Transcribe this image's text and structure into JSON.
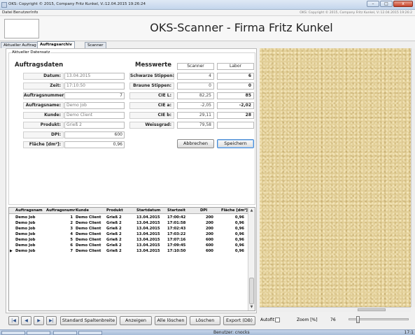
{
  "window": {
    "title": "OKS: Copyright © 2015, Company Fritz Kunkel, V.:12.04.2015 19:26:24",
    "min_label": "–",
    "max_label": "□",
    "close_label": "x"
  },
  "menu": {
    "items": [
      "Datei",
      "Benutzer",
      "Info"
    ],
    "right_text": "OKS: Copyright © 2015, Company Fritz Kunkel, V.:12.04.2015 19:26:2"
  },
  "header": {
    "title": "OKS-Scanner - Firma Fritz Kunkel"
  },
  "tabs": [
    "Aktueller Auftrag",
    "Auftragsarchiv",
    "Scanner"
  ],
  "group_label": "Aktueller Datensatz",
  "auftragsdaten": {
    "heading": "Auftragsdaten",
    "fields": [
      {
        "label": "Datum:",
        "value": "13.04.2015"
      },
      {
        "label": "Zeit:",
        "value": "17:10:50"
      },
      {
        "label": "Auftragsnummer:",
        "value": "7"
      },
      {
        "label": "Auftragsname:",
        "value": "Demo Job"
      },
      {
        "label": "Kunde:",
        "value": "Demo Client"
      },
      {
        "label": "Produkt:",
        "value": "Grieß 2"
      },
      {
        "label": "DPI:",
        "value": "600"
      },
      {
        "label": "Fläche [dm²]:",
        "value": "0,96"
      }
    ]
  },
  "messwerte": {
    "heading": "Messwerte",
    "col_scanner": "Scanner",
    "col_labor": "Labor",
    "rows": [
      {
        "label": "Schwarze Stippen:",
        "scanner": "4",
        "labor": "6"
      },
      {
        "label": "Braune Stippen:",
        "scanner": "0",
        "labor": "0"
      },
      {
        "label": "CIE L:",
        "scanner": "82,25",
        "labor": "85"
      },
      {
        "label": "CIE a:",
        "scanner": "-2,05",
        "labor": "-2,02"
      },
      {
        "label": "CIE b:",
        "scanner": "29,11",
        "labor": "28"
      },
      {
        "label": "Weissgrad:",
        "scanner": "79,58",
        "labor": ""
      }
    ]
  },
  "actions": {
    "cancel": "Abbrechen",
    "save": "Speichern"
  },
  "grid": {
    "columns": [
      "Auftragsname",
      "Auftragsnummer",
      "Kunde",
      "Produkt",
      "Startdatum",
      "Startzeit",
      "DPI",
      "Fläche [dm²]"
    ],
    "header_display": [
      "Auftragsnam",
      "Auftragsnumr",
      "Kunde",
      "Produkt",
      "Startdatum",
      "Startzeit",
      "DPI",
      "Fläche [dm²]"
    ],
    "current_row_marker": "▶",
    "rows": [
      [
        "Demo Job",
        "1",
        "Demo Client",
        "Grieß 2",
        "13.04.2015",
        "17:00:42",
        "200",
        "0,96"
      ],
      [
        "Demo Job",
        "2",
        "Demo Client",
        "Grieß 2",
        "13.04.2015",
        "17:01:58",
        "200",
        "0,96"
      ],
      [
        "Demo Job",
        "3",
        "Demo Client",
        "Grieß 2",
        "13.04.2015",
        "17:02:43",
        "200",
        "0,96"
      ],
      [
        "Demo Job",
        "4",
        "Demo Client",
        "Grieß 2",
        "13.04.2015",
        "17:03:22",
        "200",
        "0,96"
      ],
      [
        "Demo Job",
        "5",
        "Demo Client",
        "Grieß 2",
        "13.04.2015",
        "17:07:16",
        "600",
        "0,96"
      ],
      [
        "Demo Job",
        "6",
        "Demo Client",
        "Grieß 2",
        "13.04.2015",
        "17:09:45",
        "600",
        "0,96"
      ],
      [
        "Demo Job",
        "7",
        "Demo Client",
        "Grieß 2",
        "13.04.2015",
        "17:10:50",
        "600",
        "0,96"
      ]
    ],
    "current_row_index": 6
  },
  "bottom_buttons": {
    "first": "|◀",
    "prev": "◀",
    "next": "▶",
    "last": "▶|",
    "std_width": "Standard Spaltenbreite",
    "show": "Anzeigen",
    "delete_all": "Alle löschen",
    "delete": "Löschen",
    "export": "Export (DB)"
  },
  "image_controls": {
    "autofit_label": "Autofit",
    "zoom_label": "Zoom [%]",
    "zoom_value": "76",
    "zoom_fraction": 0.12
  },
  "taskbar": {
    "user_text": "Benutzer: cnocks",
    "clock": "17:1"
  },
  "colors": {
    "image_background": "#e2cf98",
    "save_focus": "#4a8bd4"
  }
}
